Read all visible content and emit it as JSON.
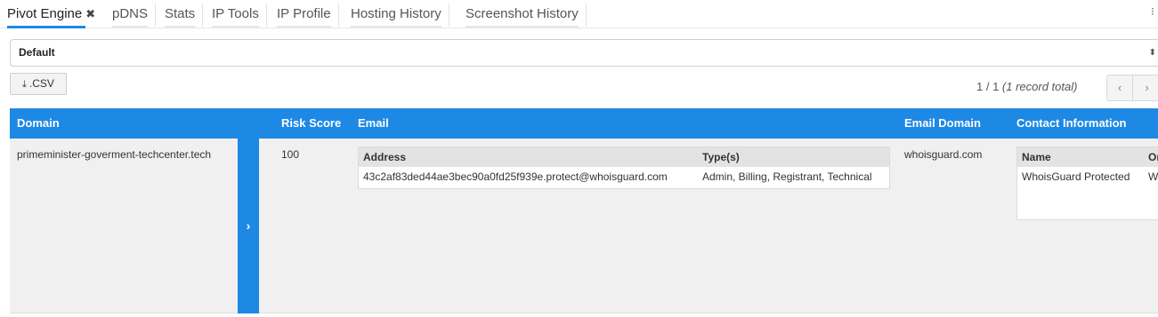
{
  "tabs": [
    {
      "label": "Pivot Engine",
      "active": true
    },
    {
      "label": "pDNS"
    },
    {
      "label": "Stats"
    },
    {
      "label": "IP Tools"
    },
    {
      "label": "IP Profile"
    },
    {
      "label": "Hosting History"
    },
    {
      "label": "Screenshot History"
    }
  ],
  "select": {
    "value": "Default"
  },
  "export": {
    "label": ".CSV"
  },
  "pagination": {
    "range": "1 / 1",
    "total": "(1 record total)"
  },
  "columns": {
    "domain": "Domain",
    "risk_score": "Risk Score",
    "email": "Email",
    "email_domain": "Email Domain",
    "contact_information": "Contact Information"
  },
  "rows": [
    {
      "domain": "primeminister-goverment-techcenter.tech",
      "risk_score": "100",
      "email_domain": "whoisguard.com",
      "email": {
        "headers": {
          "address": "Address",
          "types": "Type(s)"
        },
        "entries": [
          {
            "address": "43c2af83ded44ae3bec90a0fd25f939e.protect@whoisguard.com",
            "types": "Admin, Billing, Registrant, Technical"
          }
        ]
      },
      "contact": {
        "headers": {
          "name": "Name",
          "org": "Or"
        },
        "entries": [
          {
            "name": "WhoisGuard Protected",
            "org": "W"
          }
        ]
      }
    }
  ],
  "colors": {
    "accent": "#1e88e5",
    "row_bg": "#f0f0f0",
    "subheader_bg": "#e3e3e3"
  }
}
